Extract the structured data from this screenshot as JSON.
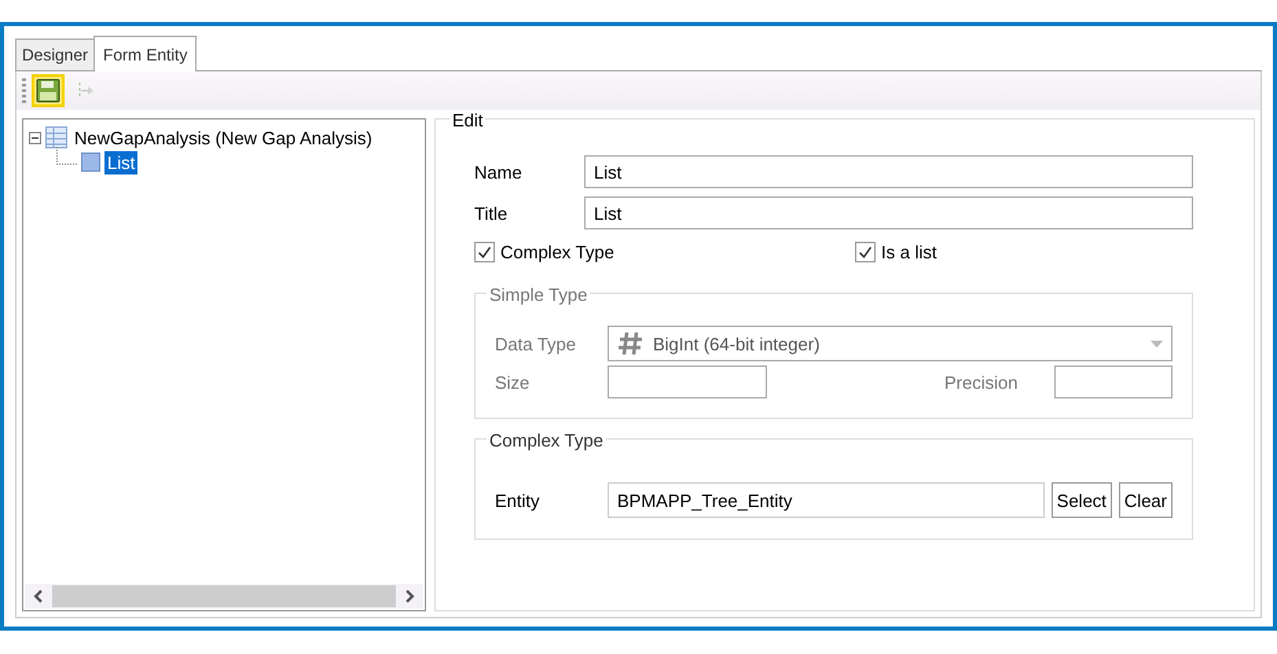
{
  "tabs": [
    {
      "label": "Designer",
      "selected": false
    },
    {
      "label": "Form Entity",
      "selected": true
    }
  ],
  "toolbar": [
    {
      "kind": "save",
      "highlighted": true,
      "disabled": false
    },
    {
      "kind": "tree-step",
      "highlighted": false,
      "disabled": true
    }
  ],
  "tree": [
    {
      "label": "NewGapAnalysis (New Gap Analysis)",
      "expanded": true,
      "selected": false,
      "children": [
        {
          "label": "List",
          "selected": true
        }
      ]
    }
  ],
  "edit": {
    "title": "Edit",
    "name_label": "Name",
    "name_value": "List",
    "title_label": "Title",
    "title_value": "List",
    "checkboxes": [
      {
        "label": "Complex Type",
        "checked": true
      },
      {
        "label": "Is a list",
        "checked": true
      }
    ],
    "simple_type": {
      "title": "Simple Type",
      "disabled": true,
      "data_type_label": "Data Type",
      "data_type_value": "BigInt (64-bit integer)",
      "size_label": "Size",
      "precision_label": "Precision"
    },
    "complex_type": {
      "title": "Complex Type",
      "entity_label": "Entity",
      "entity_value": "BPMAPP_Tree_Entity",
      "buttons": [
        "Select",
        "Clear"
      ]
    }
  }
}
